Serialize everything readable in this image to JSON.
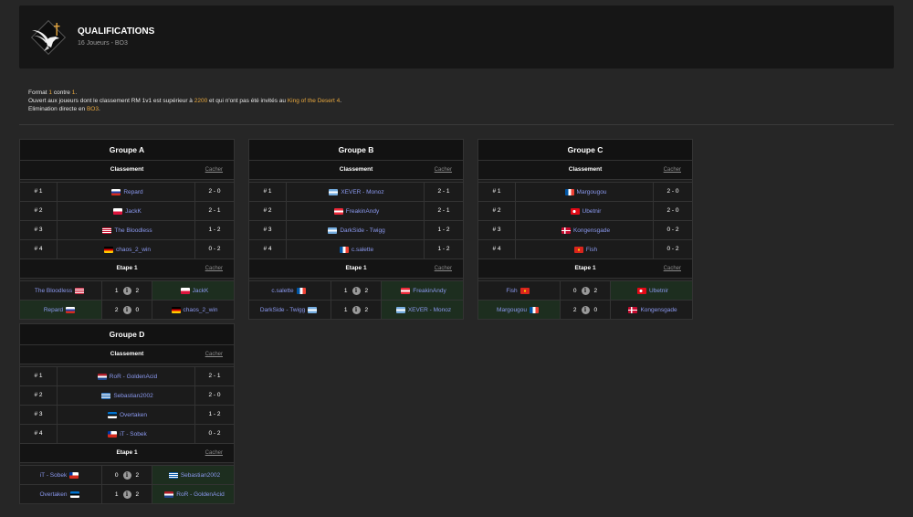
{
  "header": {
    "title": "QUALIFICATIONS",
    "subtitle": "16 Joueurs - BO3"
  },
  "info": {
    "l1a": "Format ",
    "l1b": "1",
    "l1c": " contre ",
    "l1d": "1",
    "l1e": ".",
    "l2a": "Ouvert aux joueurs dont le classement RM 1v1 est supérieur à ",
    "l2b": "2200",
    "l2c": " et qui n'ont pas été invités au ",
    "l2d": "King of the Desert 4",
    "l2e": ".",
    "l3a": "Elimination directe en ",
    "l3b": "BO3",
    "l3c": "."
  },
  "labels": {
    "ranking": "Classement",
    "stage": "Etape 1",
    "hide": "Cacher"
  },
  "groups": [
    {
      "title": "Groupe A",
      "standings": [
        {
          "rank": "# 1",
          "flag": "ru",
          "name": "Repard",
          "rec": "2 - 0"
        },
        {
          "rank": "# 2",
          "flag": "pl",
          "name": "JackK",
          "rec": "2 - 1"
        },
        {
          "rank": "# 3",
          "flag": "us",
          "name": "The Bloodless",
          "rec": "1 - 2"
        },
        {
          "rank": "# 4",
          "flag": "de",
          "name": "chaos_2_win",
          "rec": "0 - 2"
        }
      ],
      "matches": [
        {
          "p1": "The Bloodless",
          "f1": "us",
          "s1": "1",
          "s2": "2",
          "p2": "JackK",
          "f2": "pl",
          "winner": 2
        },
        {
          "p1": "Repard",
          "f1": "ru",
          "s1": "2",
          "s2": "0",
          "p2": "chaos_2_win",
          "f2": "de",
          "winner": 1
        }
      ]
    },
    {
      "title": "Groupe B",
      "standings": [
        {
          "rank": "# 1",
          "flag": "ar",
          "name": "XEVER - Monoz",
          "rec": "2 - 1"
        },
        {
          "rank": "# 2",
          "flag": "at",
          "name": "FreakinAndy",
          "rec": "2 - 1"
        },
        {
          "rank": "# 3",
          "flag": "ar",
          "name": "DarkSide - Twigg",
          "rec": "1 - 2"
        },
        {
          "rank": "# 4",
          "flag": "fr",
          "name": "c.salette",
          "rec": "1 - 2"
        }
      ],
      "matches": [
        {
          "p1": "c.salette",
          "f1": "fr",
          "s1": "1",
          "s2": "2",
          "p2": "FreakinAndy",
          "f2": "at",
          "winner": 2
        },
        {
          "p1": "DarkSide - Twigg",
          "f1": "ar",
          "s1": "1",
          "s2": "2",
          "p2": "XEVER - Monoz",
          "f2": "ar",
          "winner": 2
        }
      ]
    },
    {
      "title": "Groupe C",
      "standings": [
        {
          "rank": "# 1",
          "flag": "fr",
          "name": "Margougou",
          "rec": "2 - 0"
        },
        {
          "rank": "# 2",
          "flag": "tr",
          "name": "Ubetnir",
          "rec": "2 - 0"
        },
        {
          "rank": "# 3",
          "flag": "dk",
          "name": "Kongensgade",
          "rec": "0 - 2"
        },
        {
          "rank": "# 4",
          "flag": "vn",
          "name": "Fish",
          "rec": "0 - 2"
        }
      ],
      "matches": [
        {
          "p1": "Fish",
          "f1": "vn",
          "s1": "0",
          "s2": "2",
          "p2": "Ubetnir",
          "f2": "tr",
          "winner": 2
        },
        {
          "p1": "Margougou",
          "f1": "fr",
          "s1": "2",
          "s2": "0",
          "p2": "Kongensgade",
          "f2": "dk",
          "winner": 1
        }
      ]
    },
    {
      "title": "Groupe D",
      "standings": [
        {
          "rank": "# 1",
          "flag": "nl",
          "name": "RoR - GoldenAcid",
          "rec": "2 - 1"
        },
        {
          "rank": "# 2",
          "flag": "gr",
          "name": "Sebastian2002",
          "rec": "2 - 0"
        },
        {
          "rank": "# 3",
          "flag": "ee",
          "name": "Overtaken",
          "rec": "1 - 2"
        },
        {
          "rank": "# 4",
          "flag": "cl",
          "name": "iT - Sobek",
          "rec": "0 - 2"
        }
      ],
      "matches": [
        {
          "p1": "iT - Sobek",
          "f1": "cl",
          "s1": "0",
          "s2": "2",
          "p2": "Sebastian2002",
          "f2": "gr",
          "winner": 2
        },
        {
          "p1": "Overtaken",
          "f1": "ee",
          "s1": "1",
          "s2": "2",
          "p2": "RoR - GoldenAcid",
          "f2": "nl",
          "winner": 2
        }
      ]
    }
  ]
}
